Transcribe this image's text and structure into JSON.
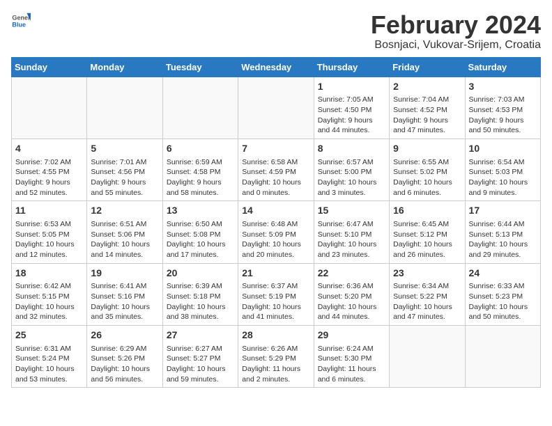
{
  "header": {
    "logo_general": "General",
    "logo_blue": "Blue",
    "title": "February 2024",
    "subtitle": "Bosnjaci, Vukovar-Srijem, Croatia"
  },
  "calendar": {
    "days_of_week": [
      "Sunday",
      "Monday",
      "Tuesday",
      "Wednesday",
      "Thursday",
      "Friday",
      "Saturday"
    ],
    "weeks": [
      [
        {
          "day": "",
          "detail": ""
        },
        {
          "day": "",
          "detail": ""
        },
        {
          "day": "",
          "detail": ""
        },
        {
          "day": "",
          "detail": ""
        },
        {
          "day": "1",
          "detail": "Sunrise: 7:05 AM\nSunset: 4:50 PM\nDaylight: 9 hours\nand 44 minutes."
        },
        {
          "day": "2",
          "detail": "Sunrise: 7:04 AM\nSunset: 4:52 PM\nDaylight: 9 hours\nand 47 minutes."
        },
        {
          "day": "3",
          "detail": "Sunrise: 7:03 AM\nSunset: 4:53 PM\nDaylight: 9 hours\nand 50 minutes."
        }
      ],
      [
        {
          "day": "4",
          "detail": "Sunrise: 7:02 AM\nSunset: 4:55 PM\nDaylight: 9 hours\nand 52 minutes."
        },
        {
          "day": "5",
          "detail": "Sunrise: 7:01 AM\nSunset: 4:56 PM\nDaylight: 9 hours\nand 55 minutes."
        },
        {
          "day": "6",
          "detail": "Sunrise: 6:59 AM\nSunset: 4:58 PM\nDaylight: 9 hours\nand 58 minutes."
        },
        {
          "day": "7",
          "detail": "Sunrise: 6:58 AM\nSunset: 4:59 PM\nDaylight: 10 hours\nand 0 minutes."
        },
        {
          "day": "8",
          "detail": "Sunrise: 6:57 AM\nSunset: 5:00 PM\nDaylight: 10 hours\nand 3 minutes."
        },
        {
          "day": "9",
          "detail": "Sunrise: 6:55 AM\nSunset: 5:02 PM\nDaylight: 10 hours\nand 6 minutes."
        },
        {
          "day": "10",
          "detail": "Sunrise: 6:54 AM\nSunset: 5:03 PM\nDaylight: 10 hours\nand 9 minutes."
        }
      ],
      [
        {
          "day": "11",
          "detail": "Sunrise: 6:53 AM\nSunset: 5:05 PM\nDaylight: 10 hours\nand 12 minutes."
        },
        {
          "day": "12",
          "detail": "Sunrise: 6:51 AM\nSunset: 5:06 PM\nDaylight: 10 hours\nand 14 minutes."
        },
        {
          "day": "13",
          "detail": "Sunrise: 6:50 AM\nSunset: 5:08 PM\nDaylight: 10 hours\nand 17 minutes."
        },
        {
          "day": "14",
          "detail": "Sunrise: 6:48 AM\nSunset: 5:09 PM\nDaylight: 10 hours\nand 20 minutes."
        },
        {
          "day": "15",
          "detail": "Sunrise: 6:47 AM\nSunset: 5:10 PM\nDaylight: 10 hours\nand 23 minutes."
        },
        {
          "day": "16",
          "detail": "Sunrise: 6:45 AM\nSunset: 5:12 PM\nDaylight: 10 hours\nand 26 minutes."
        },
        {
          "day": "17",
          "detail": "Sunrise: 6:44 AM\nSunset: 5:13 PM\nDaylight: 10 hours\nand 29 minutes."
        }
      ],
      [
        {
          "day": "18",
          "detail": "Sunrise: 6:42 AM\nSunset: 5:15 PM\nDaylight: 10 hours\nand 32 minutes."
        },
        {
          "day": "19",
          "detail": "Sunrise: 6:41 AM\nSunset: 5:16 PM\nDaylight: 10 hours\nand 35 minutes."
        },
        {
          "day": "20",
          "detail": "Sunrise: 6:39 AM\nSunset: 5:18 PM\nDaylight: 10 hours\nand 38 minutes."
        },
        {
          "day": "21",
          "detail": "Sunrise: 6:37 AM\nSunset: 5:19 PM\nDaylight: 10 hours\nand 41 minutes."
        },
        {
          "day": "22",
          "detail": "Sunrise: 6:36 AM\nSunset: 5:20 PM\nDaylight: 10 hours\nand 44 minutes."
        },
        {
          "day": "23",
          "detail": "Sunrise: 6:34 AM\nSunset: 5:22 PM\nDaylight: 10 hours\nand 47 minutes."
        },
        {
          "day": "24",
          "detail": "Sunrise: 6:33 AM\nSunset: 5:23 PM\nDaylight: 10 hours\nand 50 minutes."
        }
      ],
      [
        {
          "day": "25",
          "detail": "Sunrise: 6:31 AM\nSunset: 5:24 PM\nDaylight: 10 hours\nand 53 minutes."
        },
        {
          "day": "26",
          "detail": "Sunrise: 6:29 AM\nSunset: 5:26 PM\nDaylight: 10 hours\nand 56 minutes."
        },
        {
          "day": "27",
          "detail": "Sunrise: 6:27 AM\nSunset: 5:27 PM\nDaylight: 10 hours\nand 59 minutes."
        },
        {
          "day": "28",
          "detail": "Sunrise: 6:26 AM\nSunset: 5:29 PM\nDaylight: 11 hours\nand 2 minutes."
        },
        {
          "day": "29",
          "detail": "Sunrise: 6:24 AM\nSunset: 5:30 PM\nDaylight: 11 hours\nand 6 minutes."
        },
        {
          "day": "",
          "detail": ""
        },
        {
          "day": "",
          "detail": ""
        }
      ]
    ]
  }
}
